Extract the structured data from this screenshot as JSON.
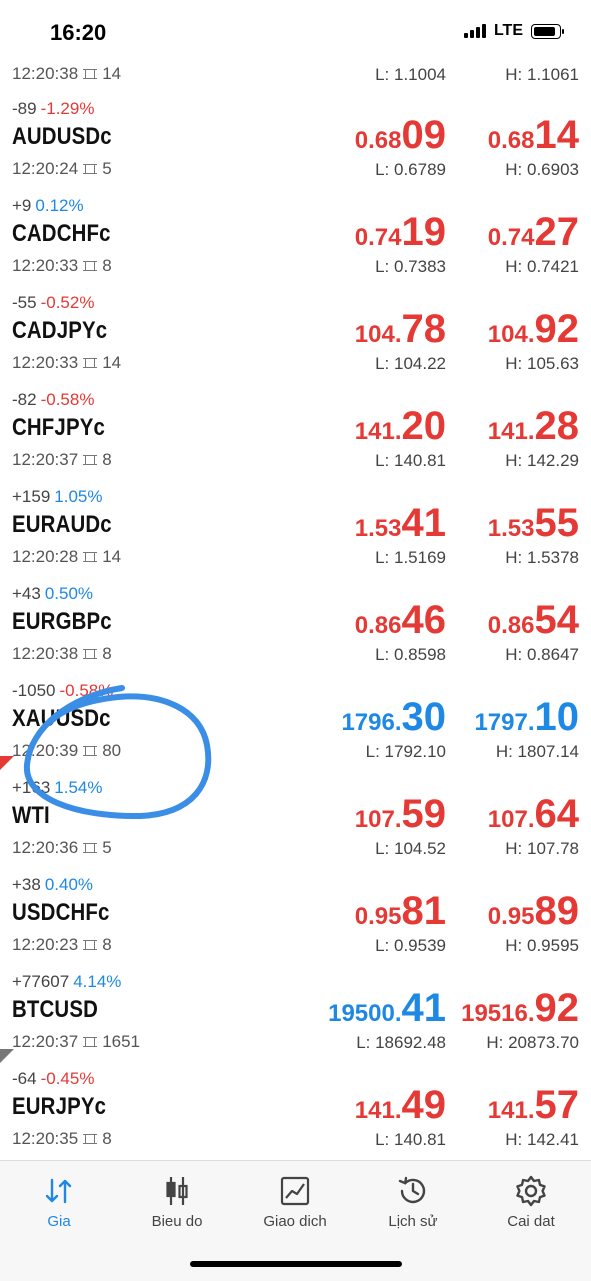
{
  "status_bar": {
    "time": "16:20",
    "network": "LTE"
  },
  "quotes_top": {
    "time": "12:20:38",
    "spread": "14",
    "low": "L: 1.1004",
    "high": "H: 1.1061"
  },
  "quotes": [
    {
      "change": "-89",
      "change_pct": "-1.29%",
      "direction": "down",
      "symbol": "AUDUSDc",
      "time": "12:20:24",
      "spread": "5",
      "bid_small": "0.68",
      "bid_big": "09",
      "ask_small": "0.68",
      "ask_big": "14",
      "bid_color": "red",
      "ask_color": "red",
      "low": "L: 0.6789",
      "high": "H: 0.6903"
    },
    {
      "change": "+9",
      "change_pct": "0.12%",
      "direction": "up",
      "symbol": "CADCHFc",
      "time": "12:20:33",
      "spread": "8",
      "bid_small": "0.74",
      "bid_big": "19",
      "ask_small": "0.74",
      "ask_big": "27",
      "bid_color": "red",
      "ask_color": "red",
      "low": "L: 0.7383",
      "high": "H: 0.7421"
    },
    {
      "change": "-55",
      "change_pct": "-0.52%",
      "direction": "down",
      "symbol": "CADJPYc",
      "time": "12:20:33",
      "spread": "14",
      "bid_small": "104.",
      "bid_big": "78",
      "ask_small": "104.",
      "ask_big": "92",
      "bid_color": "red",
      "ask_color": "red",
      "low": "L: 104.22",
      "high": "H: 105.63"
    },
    {
      "change": "-82",
      "change_pct": "-0.58%",
      "direction": "down",
      "symbol": "CHFJPYc",
      "time": "12:20:37",
      "spread": "8",
      "bid_small": "141.",
      "bid_big": "20",
      "ask_small": "141.",
      "ask_big": "28",
      "bid_color": "red",
      "ask_color": "red",
      "low": "L: 140.81",
      "high": "H: 142.29"
    },
    {
      "change": "+159",
      "change_pct": "1.05%",
      "direction": "up",
      "symbol": "EURAUDc",
      "time": "12:20:28",
      "spread": "14",
      "bid_small": "1.53",
      "bid_big": "41",
      "ask_small": "1.53",
      "ask_big": "55",
      "bid_color": "red",
      "ask_color": "red",
      "low": "L: 1.5169",
      "high": "H: 1.5378"
    },
    {
      "change": "+43",
      "change_pct": "0.50%",
      "direction": "up",
      "symbol": "EURGBPc",
      "time": "12:20:38",
      "spread": "8",
      "bid_small": "0.86",
      "bid_big": "46",
      "ask_small": "0.86",
      "ask_big": "54",
      "bid_color": "red",
      "ask_color": "red",
      "low": "L: 0.8598",
      "high": "H: 0.8647"
    },
    {
      "change": "-1050",
      "change_pct": "-0.58%",
      "direction": "down",
      "symbol": "XAUUSDc",
      "time": "12:20:39",
      "spread": "80",
      "bid_small": "1796.",
      "bid_big": "30",
      "ask_small": "1797.",
      "ask_big": "10",
      "bid_color": "blue",
      "ask_color": "blue",
      "low": "L: 1792.10",
      "high": "H: 1807.14"
    },
    {
      "change": "+163",
      "change_pct": "1.54%",
      "direction": "up",
      "symbol": "WTI",
      "time": "12:20:36",
      "spread": "5",
      "bid_small": "107.",
      "bid_big": "59",
      "ask_small": "107.",
      "ask_big": "64",
      "bid_color": "red",
      "ask_color": "red",
      "low": "L: 104.52",
      "high": "H: 107.78"
    },
    {
      "change": "+38",
      "change_pct": "0.40%",
      "direction": "up",
      "symbol": "USDCHFc",
      "time": "12:20:23",
      "spread": "8",
      "bid_small": "0.95",
      "bid_big": "81",
      "ask_small": "0.95",
      "ask_big": "89",
      "bid_color": "red",
      "ask_color": "red",
      "low": "L: 0.9539",
      "high": "H: 0.9595"
    },
    {
      "change": "+77607",
      "change_pct": "4.14%",
      "direction": "up",
      "symbol": "BTCUSD",
      "time": "12:20:37",
      "spread": "1651",
      "bid_small": "19500.",
      "bid_big": "41",
      "ask_small": "19516.",
      "ask_big": "92",
      "bid_color": "blue",
      "ask_color": "red",
      "low": "L: 18692.48",
      "high": "H: 20873.70"
    },
    {
      "change": "-64",
      "change_pct": "-0.45%",
      "direction": "down",
      "symbol": "EURJPYc",
      "time": "12:20:35",
      "spread": "8",
      "bid_small": "141.",
      "bid_big": "49",
      "ask_small": "141.",
      "ask_big": "57",
      "bid_color": "red",
      "ask_color": "red",
      "low": "L: 140.81",
      "high": "H: 142.41"
    }
  ],
  "tabs": [
    {
      "label": "Gia",
      "icon": "quotes-arrows-icon",
      "active": true
    },
    {
      "label": "Bieu do",
      "icon": "candlestick-chart-icon",
      "active": false
    },
    {
      "label": "Giao dich",
      "icon": "trade-chart-icon",
      "active": false
    },
    {
      "label": "Lịch sử",
      "icon": "history-clock-icon",
      "active": false
    },
    {
      "label": "Cai dat",
      "icon": "settings-gear-icon",
      "active": false
    }
  ],
  "colors": {
    "down": "#e53935",
    "up": "#1e88e5",
    "annotation": "#3a8ee6",
    "active_tab": "#1e88e5"
  }
}
